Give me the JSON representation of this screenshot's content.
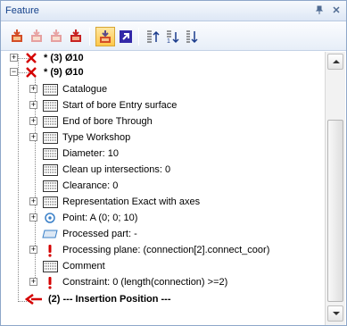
{
  "window": {
    "title": "Feature",
    "pin": "1",
    "close": "×"
  },
  "toolbar": {
    "icons": [
      "insert-icon",
      "insert-disabled-icon",
      "insert-disabled-icon",
      "insert-red-icon",
      "feature-active-icon",
      "go-to-icon",
      "sort-up-icon",
      "sort-down-icon",
      "sort-options-icon"
    ]
  },
  "tree": {
    "nodes": [
      {
        "label": "* (3)  Ø10",
        "bold": true
      },
      {
        "label": "* (9)  Ø10",
        "bold": true
      },
      {
        "label": "Catalogue"
      },
      {
        "label": "Start of bore Entry surface"
      },
      {
        "label": "End of bore Through"
      },
      {
        "label": "Type Workshop"
      },
      {
        "label": "Diameter: 10"
      },
      {
        "label": "Clean up intersections: 0"
      },
      {
        "label": "Clearance: 0"
      },
      {
        "label": "Representation Exact with axes"
      },
      {
        "label": "Point: A   (0; 0; 10)"
      },
      {
        "label": "Processed part: -"
      },
      {
        "label": "Processing plane: (connection[2].connect_coor)"
      },
      {
        "label": "Comment"
      },
      {
        "label": "Constraint: 0 (length(connection) >=2)"
      },
      {
        "label": "(2) --- Insertion Position ---",
        "bold": true
      }
    ]
  },
  "colors": {
    "accent": "#15428b",
    "error": "#d40000",
    "brand": "#3a80c8"
  }
}
